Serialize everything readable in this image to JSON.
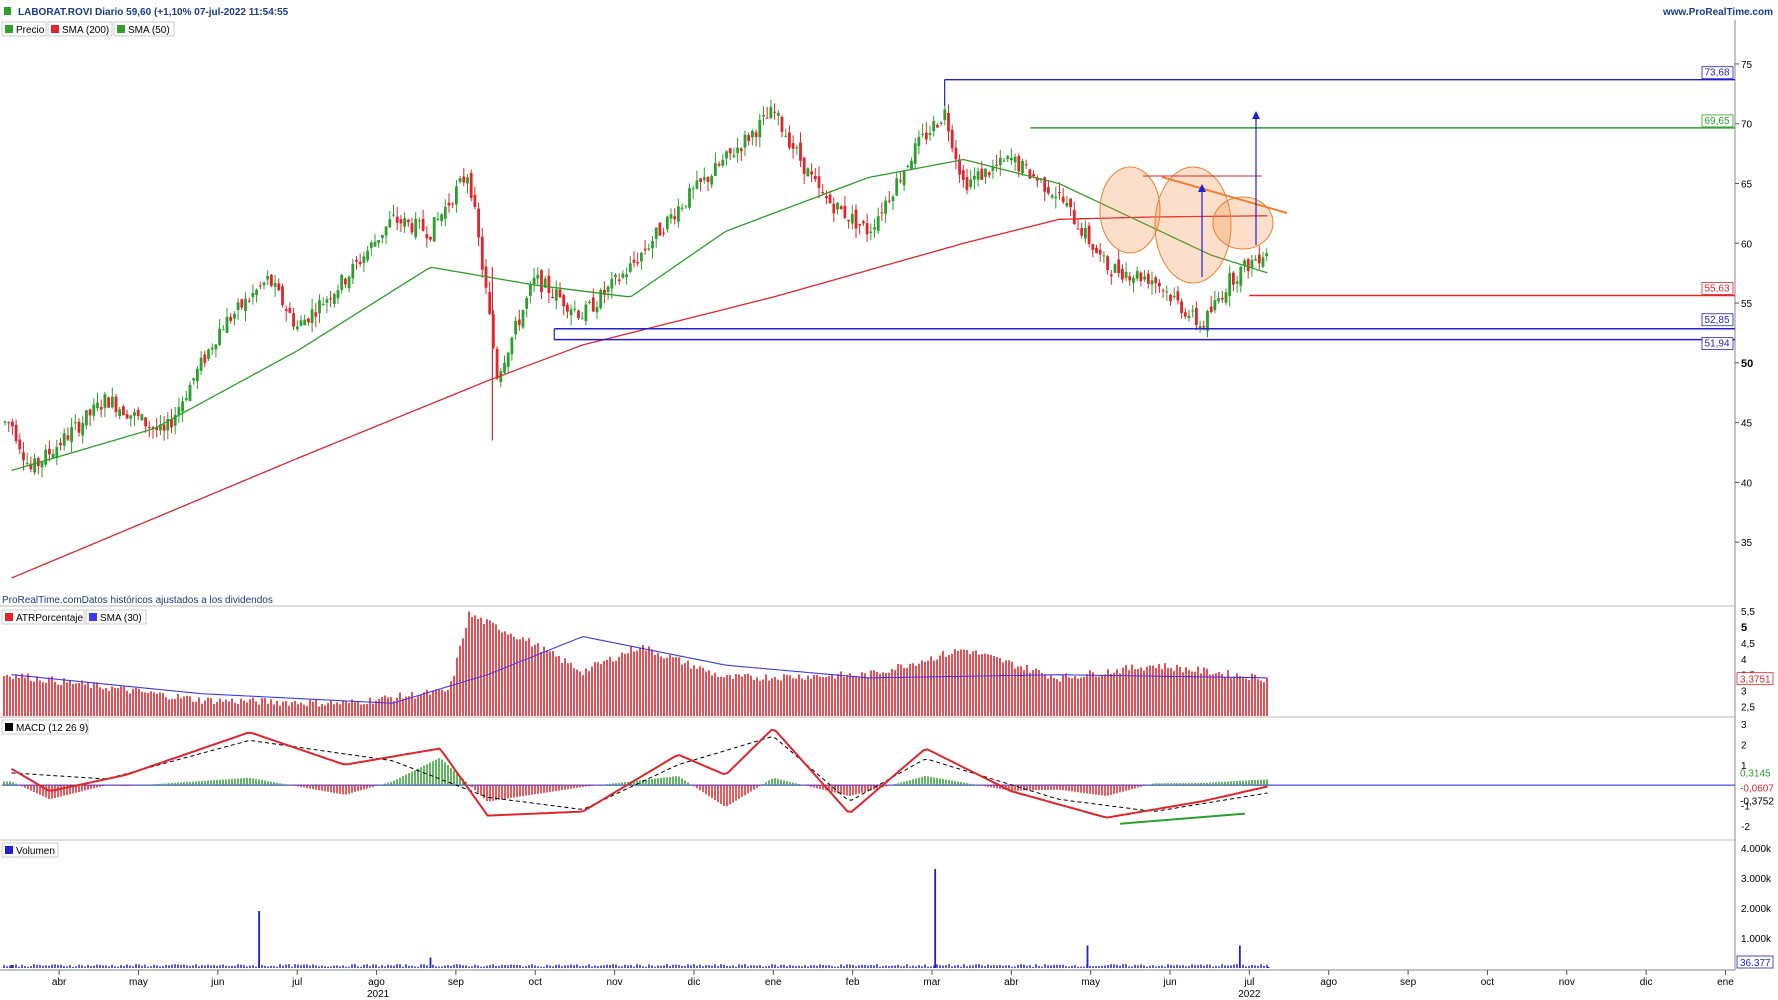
{
  "header": {
    "title": "LABORAT.ROVI Diario 59,60 (+1,10% 07-jul-2022 11:54:55",
    "site": "www.ProRealTime.com",
    "note": "ProRealTime.comDatos históricos ajustados a los dividendos"
  },
  "colors": {
    "up": "#2ca02c",
    "down": "#e3242b",
    "sma200": "#e3242b",
    "sma50": "#2ca02c",
    "blue": "#1f1fd6",
    "atr": "#e3242b",
    "atr_sma": "#3a3af0",
    "macd": "#e3242b",
    "signal": "#000000",
    "hist_pos": "#2ca02c",
    "hist_neg": "#e3242b",
    "volume": "#1f1fd6",
    "trend": "#f08030"
  },
  "legends": {
    "price": [
      "Precio",
      "SMA (200)",
      "SMA (50)"
    ],
    "atr": [
      "ATRPorcentaje",
      "SMA (30)"
    ],
    "macd": [
      "MACD (12 26 9)"
    ],
    "volume": [
      "Volumen"
    ]
  },
  "chart_data": [
    {
      "type": "candlestick",
      "title": "LABORAT.ROVI Diario",
      "ylim": [
        31,
        77
      ],
      "y_ticks": [
        "75",
        "70",
        "65",
        "60",
        "55",
        "50",
        "45",
        "40",
        "35"
      ],
      "series": [
        {
          "name": "Precio",
          "values": [
            [
              2021.2,
              45
            ],
            [
              2021.22,
              41
            ],
            [
              2021.3,
              47
            ],
            [
              2021.36,
              44
            ],
            [
              2021.42,
              53
            ],
            [
              2021.47,
              57
            ],
            [
              2021.5,
              53
            ],
            [
              2021.55,
              57
            ],
            [
              2021.6,
              62
            ],
            [
              2021.64,
              61
            ],
            [
              2021.68,
              66
            ],
            [
              2021.7,
              55
            ],
            [
              2021.71,
              49
            ],
            [
              2021.75,
              57
            ],
            [
              2021.8,
              54
            ],
            [
              2021.85,
              58
            ],
            [
              2021.9,
              63
            ],
            [
              2021.95,
              67
            ],
            [
              2022.0,
              71
            ],
            [
              2022.05,
              64
            ],
            [
              2022.1,
              61
            ],
            [
              2022.15,
              68
            ],
            [
              2022.18,
              71
            ],
            [
              2022.2,
              65
            ],
            [
              2022.25,
              67
            ],
            [
              2022.3,
              64
            ],
            [
              2022.35,
              58
            ],
            [
              2022.4,
              57
            ],
            [
              2022.45,
              53
            ],
            [
              2022.48,
              57
            ],
            [
              2022.52,
              59.6
            ]
          ]
        },
        {
          "name": "SMA (200)",
          "values": [
            [
              2021.2,
              32
            ],
            [
              2021.5,
              42
            ],
            [
              2021.7,
              48.5
            ],
            [
              2021.8,
              51.5
            ],
            [
              2022.0,
              55.5
            ],
            [
              2022.2,
              60
            ],
            [
              2022.3,
              62
            ],
            [
              2022.4,
              62.2
            ],
            [
              2022.52,
              62.3
            ]
          ]
        },
        {
          "name": "SMA (50)",
          "values": [
            [
              2021.2,
              41
            ],
            [
              2021.35,
              44.5
            ],
            [
              2021.5,
              51
            ],
            [
              2021.64,
              58
            ],
            [
              2021.75,
              56.5
            ],
            [
              2021.85,
              55.5
            ],
            [
              2021.95,
              61
            ],
            [
              2022.1,
              65.5
            ],
            [
              2022.2,
              67
            ],
            [
              2022.3,
              65
            ],
            [
              2022.38,
              62
            ],
            [
              2022.46,
              59
            ],
            [
              2022.52,
              57.5
            ]
          ]
        }
      ],
      "levels": [
        {
          "value": "73,68",
          "color": "#1f1fd6"
        },
        {
          "value": "69,65",
          "color": "#2ca02c"
        },
        {
          "value": "55,63",
          "color": "#e3242b"
        },
        {
          "value": "52,85",
          "color": "#1f1fd6"
        },
        {
          "value": "51,94",
          "color": "#1f1fd6"
        }
      ]
    },
    {
      "type": "bar",
      "title": "ATRPorcentaje",
      "ylim": [
        2.2,
        5.6
      ],
      "y_ticks": [
        "5,5",
        "5",
        "4,5",
        "4",
        "3,5",
        "3",
        "2,5"
      ],
      "last_value": "3,3751",
      "series": [
        {
          "name": "ATRPorcentaje",
          "values": [
            [
              2021.2,
              3.5
            ],
            [
              2021.4,
              2.7
            ],
            [
              2021.55,
              2.6
            ],
            [
              2021.66,
              3.0
            ],
            [
              2021.68,
              5.4
            ],
            [
              2021.74,
              4.6
            ],
            [
              2021.8,
              3.6
            ],
            [
              2021.86,
              4.4
            ],
            [
              2021.95,
              3.4
            ],
            [
              2022.1,
              3.5
            ],
            [
              2022.2,
              4.3
            ],
            [
              2022.3,
              3.4
            ],
            [
              2022.4,
              3.8
            ],
            [
              2022.52,
              3.3751
            ]
          ]
        },
        {
          "name": "SMA (30)",
          "values": [
            [
              2021.2,
              3.5
            ],
            [
              2021.4,
              2.9
            ],
            [
              2021.6,
              2.6
            ],
            [
              2021.7,
              3.5
            ],
            [
              2021.8,
              4.7
            ],
            [
              2021.95,
              3.8
            ],
            [
              2022.1,
              3.4
            ],
            [
              2022.3,
              3.5
            ],
            [
              2022.52,
              3.4
            ]
          ]
        }
      ]
    },
    {
      "type": "line",
      "title": "MACD (12 26 9)",
      "ylim": [
        -2.6,
        3.2
      ],
      "y_ticks": [
        "3",
        "2",
        "1",
        "-1",
        "-2"
      ],
      "value_labels": [
        "0,3145",
        "-0,0607",
        "-0,3752"
      ],
      "series": [
        {
          "name": "MACD",
          "values": [
            [
              2021.2,
              0.8
            ],
            [
              2021.24,
              -0.3
            ],
            [
              2021.32,
              0.5
            ],
            [
              2021.45,
              2.6
            ],
            [
              2021.55,
              1.0
            ],
            [
              2021.65,
              1.8
            ],
            [
              2021.7,
              -1.5
            ],
            [
              2021.8,
              -1.3
            ],
            [
              2021.9,
              1.5
            ],
            [
              2021.95,
              0.5
            ],
            [
              2022.0,
              2.8
            ],
            [
              2022.08,
              -1.4
            ],
            [
              2022.16,
              1.8
            ],
            [
              2022.25,
              -0.3
            ],
            [
              2022.35,
              -1.6
            ],
            [
              2022.45,
              -0.8
            ],
            [
              2022.52,
              -0.06
            ]
          ]
        },
        {
          "name": "Señal",
          "values": [
            [
              2021.2,
              0.6
            ],
            [
              2021.3,
              0.3
            ],
            [
              2021.45,
              2.2
            ],
            [
              2021.6,
              1.2
            ],
            [
              2021.7,
              -0.6
            ],
            [
              2021.8,
              -1.2
            ],
            [
              2021.9,
              1.0
            ],
            [
              2022.0,
              2.4
            ],
            [
              2022.08,
              -0.8
            ],
            [
              2022.16,
              1.3
            ],
            [
              2022.3,
              -0.7
            ],
            [
              2022.4,
              -1.3
            ],
            [
              2022.52,
              -0.38
            ]
          ]
        }
      ]
    },
    {
      "type": "bar",
      "title": "Volumen",
      "ylim": [
        0,
        4200000
      ],
      "y_ticks": [
        "4.000k",
        "3.000k",
        "2.000k",
        "1.000k"
      ],
      "last_value": "36.377",
      "x_ticks": [
        "abr",
        "may",
        "jun",
        "jul",
        "ago",
        "sep",
        "oct",
        "nov",
        "dic",
        "ene",
        "feb",
        "mar",
        "abr",
        "may",
        "jun",
        "jul",
        "ago",
        "sep",
        "oct",
        "nov",
        "dic",
        "ene"
      ],
      "year_labels": [
        "2021",
        "2022"
      ],
      "series": [
        {
          "name": "Volumen",
          "values": [
            [
              2021.2,
              100000
            ],
            [
              2021.46,
              1900000
            ],
            [
              2021.64,
              350000
            ],
            [
              2022.17,
              3300000
            ],
            [
              2022.33,
              750000
            ],
            [
              2022.49,
              750000
            ],
            [
              2022.52,
              36377
            ]
          ]
        }
      ]
    }
  ]
}
